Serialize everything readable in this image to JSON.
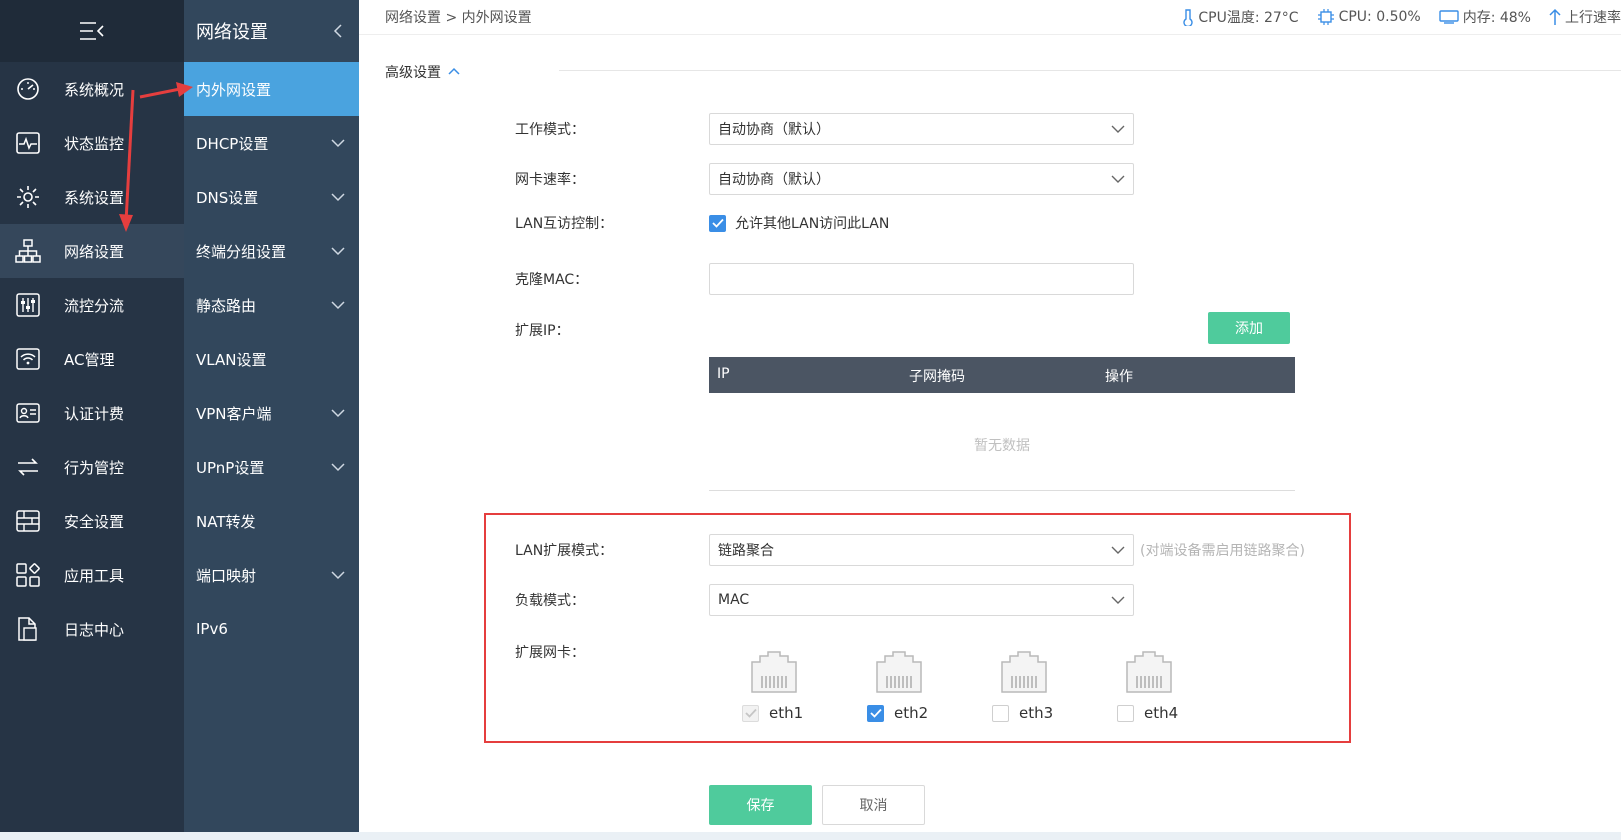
{
  "sidebar": {
    "items": [
      {
        "label": "系统概况",
        "icon": "dashboard-icon"
      },
      {
        "label": "状态监控",
        "icon": "monitor-icon"
      },
      {
        "label": "系统设置",
        "icon": "gear-icon"
      },
      {
        "label": "网络设置",
        "icon": "network-icon"
      },
      {
        "label": "流控分流",
        "icon": "sliders-icon"
      },
      {
        "label": "AC管理",
        "icon": "wifi-icon"
      },
      {
        "label": "认证计费",
        "icon": "id-card-icon"
      },
      {
        "label": "行为管控",
        "icon": "swap-icon"
      },
      {
        "label": "安全设置",
        "icon": "firewall-icon"
      },
      {
        "label": "应用工具",
        "icon": "apps-icon"
      },
      {
        "label": "日志中心",
        "icon": "log-icon"
      }
    ]
  },
  "subnav": {
    "title": "网络设置",
    "items": [
      {
        "label": "内外网设置"
      },
      {
        "label": "DHCP设置"
      },
      {
        "label": "DNS设置"
      },
      {
        "label": "终端分组设置"
      },
      {
        "label": "静态路由"
      },
      {
        "label": "VLAN设置"
      },
      {
        "label": "VPN客户端"
      },
      {
        "label": "UPnP设置"
      },
      {
        "label": "NAT转发"
      },
      {
        "label": "端口映射"
      },
      {
        "label": "IPv6"
      }
    ]
  },
  "breadcrumb": "网络设置 > 内外网设置",
  "status": {
    "cpu_temp": "CPU温度: 27°C",
    "cpu": "CPU: 0.50%",
    "memory": "内存: 48%",
    "upload": "上行速率"
  },
  "section": {
    "title": "高级设置"
  },
  "form": {
    "work_mode": {
      "label": "工作模式：",
      "value": "自动协商（默认）"
    },
    "nic_speed": {
      "label": "网卡速率：",
      "value": "自动协商（默认）"
    },
    "lan_access": {
      "label": "LAN互访控制：",
      "checkbox_label": "允许其他LAN访问此LAN",
      "checked": true
    },
    "clone_mac": {
      "label": "克隆MAC：",
      "value": ""
    },
    "ext_ip": {
      "label": "扩展IP：",
      "add_label": "添加"
    },
    "table": {
      "columns": [
        "IP",
        "子网掩码",
        "操作"
      ],
      "empty": "暂无数据"
    },
    "lan_ext_mode": {
      "label": "LAN扩展模式：",
      "value": "链路聚合",
      "hint": "(对端设备需启用链路聚合)"
    },
    "load_mode": {
      "label": "负载模式：",
      "value": "MAC"
    },
    "ext_nic": {
      "label": "扩展网卡：",
      "ports": [
        {
          "name": "eth1",
          "state": "disabled-checked"
        },
        {
          "name": "eth2",
          "state": "checked"
        },
        {
          "name": "eth3",
          "state": "unchecked"
        },
        {
          "name": "eth4",
          "state": "unchecked"
        }
      ]
    },
    "save": "保存",
    "cancel": "取消"
  },
  "colors": {
    "accent": "#4aa3df",
    "green": "#4fcb9c",
    "highlight": "#e53e3e"
  }
}
